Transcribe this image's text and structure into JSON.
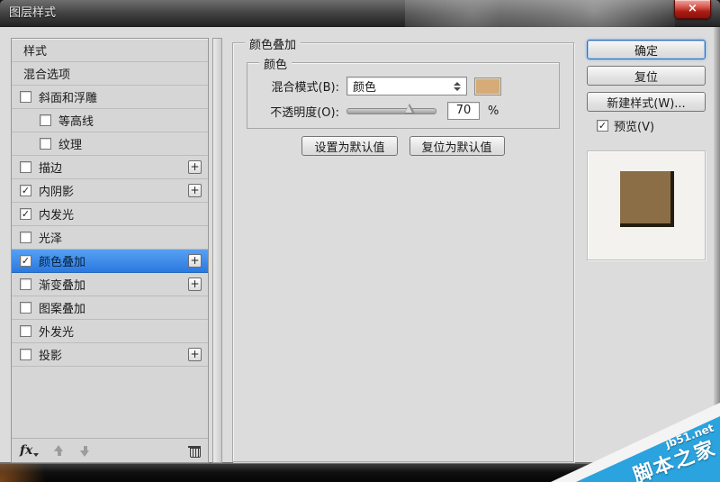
{
  "window": {
    "title": "图层样式",
    "close_glyph": "×"
  },
  "ui": {
    "check_glyph": "✓",
    "plus_glyph": "+"
  },
  "sidebar": {
    "items": [
      {
        "label": "样式",
        "checkbox": null,
        "indent": false,
        "plus": false,
        "selected": false
      },
      {
        "label": "混合选项",
        "checkbox": null,
        "indent": false,
        "plus": false,
        "selected": false
      },
      {
        "label": "斜面和浮雕",
        "checkbox": false,
        "indent": false,
        "plus": false,
        "selected": false
      },
      {
        "label": "等高线",
        "checkbox": false,
        "indent": true,
        "plus": false,
        "selected": false
      },
      {
        "label": "纹理",
        "checkbox": false,
        "indent": true,
        "plus": false,
        "selected": false
      },
      {
        "label": "描边",
        "checkbox": false,
        "indent": false,
        "plus": true,
        "selected": false
      },
      {
        "label": "内阴影",
        "checkbox": true,
        "indent": false,
        "plus": true,
        "selected": false
      },
      {
        "label": "内发光",
        "checkbox": true,
        "indent": false,
        "plus": false,
        "selected": false
      },
      {
        "label": "光泽",
        "checkbox": false,
        "indent": false,
        "plus": false,
        "selected": false
      },
      {
        "label": "颜色叠加",
        "checkbox": true,
        "indent": false,
        "plus": true,
        "selected": true
      },
      {
        "label": "渐变叠加",
        "checkbox": false,
        "indent": false,
        "plus": true,
        "selected": false
      },
      {
        "label": "图案叠加",
        "checkbox": false,
        "indent": false,
        "plus": false,
        "selected": false
      },
      {
        "label": "外发光",
        "checkbox": false,
        "indent": false,
        "plus": false,
        "selected": false
      },
      {
        "label": "投影",
        "checkbox": false,
        "indent": false,
        "plus": true,
        "selected": false
      }
    ],
    "footer": {
      "fx_label": "fx"
    }
  },
  "panel": {
    "section_title": "颜色叠加",
    "group_title": "颜色",
    "blend_mode_label": "混合模式(B):",
    "blend_mode_value": "颜色",
    "opacity_label": "不透明度(O):",
    "opacity_value": "70",
    "opacity_unit": "%",
    "opacity_percent": 70,
    "swatch_color": "#d5ab77",
    "set_default_label": "设置为默认值",
    "reset_default_label": "复位为默认值"
  },
  "actions": {
    "ok_label": "确定",
    "reset_label": "复位",
    "new_style_label": "新建样式(W)...",
    "preview_label": "预览(V)",
    "preview_checked": true,
    "preview_swatch_color": "#8b6e46"
  },
  "watermark": {
    "site": "jb51.net",
    "name": "脚本之家",
    "color": "#2aa3df"
  }
}
